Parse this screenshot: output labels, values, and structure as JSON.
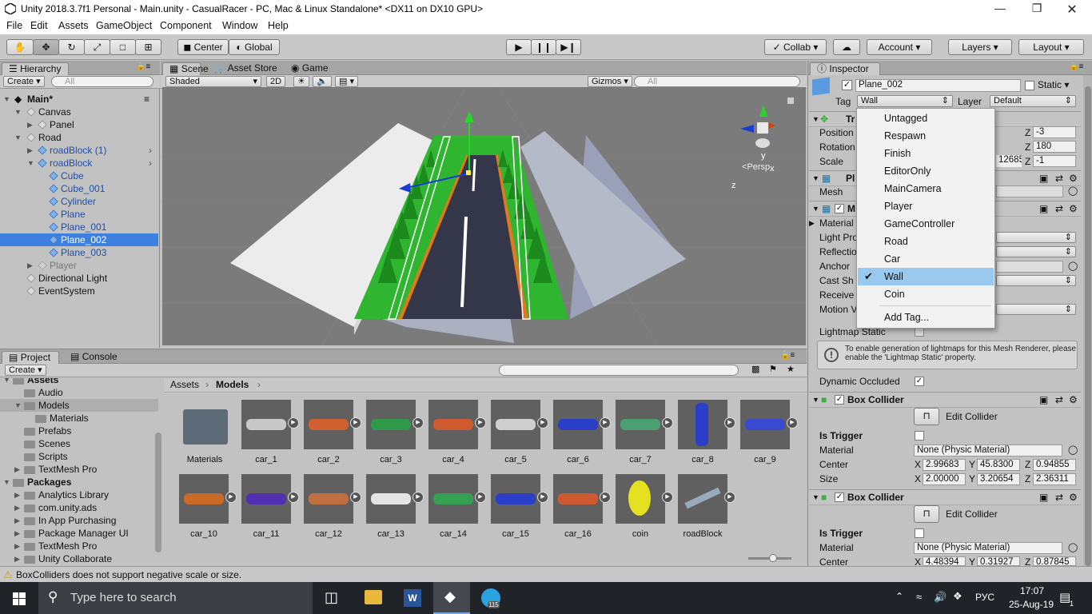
{
  "window": {
    "title": "Unity 2018.3.7f1 Personal - Main.unity - CasualRacer - PC, Mac & Linux Standalone* <DX11 on DX10 GPU>"
  },
  "menu": [
    "File",
    "Edit",
    "Assets",
    "GameObject",
    "Component",
    "Window",
    "Help"
  ],
  "toolbar": {
    "center": "Center",
    "global": "Global",
    "collab": "Collab",
    "account": "Account",
    "layers": "Layers",
    "layout": "Layout"
  },
  "hierarchy": {
    "tab": "Hierarchy",
    "create": "Create",
    "search_placeholder": "All",
    "scene": "Main*",
    "rows": [
      "Canvas",
      "Panel",
      "Road",
      "roadBlock (1)",
      "roadBlock",
      "Cube",
      "Cube_001",
      "Cylinder",
      "Plane",
      "Plane_001",
      "Plane_002",
      "Plane_003",
      "Player",
      "Directional Light",
      "EventSystem"
    ]
  },
  "scene": {
    "tabs": [
      "Scene",
      "Asset Store",
      "Game"
    ],
    "shading": "Shaded",
    "mode2d": "2D",
    "gizmos": "Gizmos",
    "search_placeholder": "All",
    "persp": "Persp",
    "axis_x": "x",
    "axis_y": "y",
    "axis_z": "z"
  },
  "project": {
    "tabs": [
      "Project",
      "Console"
    ],
    "create": "Create",
    "tree": [
      "Assets",
      "Audio",
      "Models",
      "Materials",
      "Prefabs",
      "Scenes",
      "Scripts",
      "TextMesh Pro",
      "Packages",
      "Analytics Library",
      "com.unity.ads",
      "In App Purchasing",
      "Package Manager UI",
      "TextMesh Pro",
      "Unity Collaborate"
    ],
    "breadcrumb": [
      "Assets",
      "Models"
    ],
    "assets": [
      "Materials",
      "car_1",
      "car_2",
      "car_3",
      "car_4",
      "car_5",
      "car_6",
      "car_7",
      "car_8",
      "car_9",
      "car_10",
      "car_11",
      "car_12",
      "car_13",
      "car_14",
      "car_15",
      "car_16",
      "coin",
      "roadBlock"
    ]
  },
  "inspector": {
    "tab": "Inspector",
    "name": "Plane_002",
    "static": "Static",
    "tag_label": "Tag",
    "tag": "Wall",
    "layer_label": "Layer",
    "layer": "Default",
    "transform": {
      "title": "Tr",
      "position": "Position",
      "rotation": "Rotation",
      "scale": "Scale",
      "z": "Z",
      "pz": "-3",
      "rz": "180",
      "sz": "-1",
      "sx_partial": "12685"
    },
    "mesh_filter": {
      "title": "Pl",
      "mesh": "Mesh"
    },
    "renderer": {
      "title": "M",
      "rows": [
        "Material",
        "Light Pro",
        "Reflectio",
        "Anchor",
        "Cast Sh",
        "Receive",
        "Motion V"
      ],
      "lightmap_static": "Lightmap Static",
      "info": "To enable generation of lightmaps for this Mesh Renderer, please enable the 'Lightmap Static' property.",
      "dynamic_occluded": "Dynamic Occluded"
    },
    "box1": {
      "title": "Box Collider",
      "edit": "Edit Collider",
      "is_trigger": "Is Trigger",
      "material": "Material",
      "material_value": "None (Physic Material)",
      "center": "Center",
      "size": "Size",
      "cx": "2.99683",
      "cy": "45.8300",
      "cz": "0.94855",
      "szx": "2.00000",
      "szy": "3.20654",
      "szz": "2.36311"
    },
    "box2": {
      "title": "Box Collider",
      "edit": "Edit Collider",
      "is_trigger": "Is Trigger",
      "material": "Material",
      "material_value": "None (Physic Material)",
      "center": "Center",
      "cx": "4.48394",
      "cy": "0.31927",
      "cz": "0.87845"
    }
  },
  "tag_menu": {
    "items": [
      "Untagged",
      "Respawn",
      "Finish",
      "EditorOnly",
      "MainCamera",
      "Player",
      "GameController",
      "Road",
      "Car",
      "Wall",
      "Coin"
    ],
    "selected": "Wall",
    "add": "Add Tag..."
  },
  "status": "BoxColliders does not support negative scale or size.",
  "taskbar": {
    "search_placeholder": "Type here to search",
    "lang": "РУС",
    "time": "17:07",
    "date": "25-Aug-19",
    "notif": "1",
    "badge": "115"
  },
  "colors": {
    "accent": "#3d80df",
    "menu_selected": "#99c9ef",
    "grass": "#2fb52f",
    "road": "#34364a",
    "sky_bg": "#7f7f7f"
  }
}
